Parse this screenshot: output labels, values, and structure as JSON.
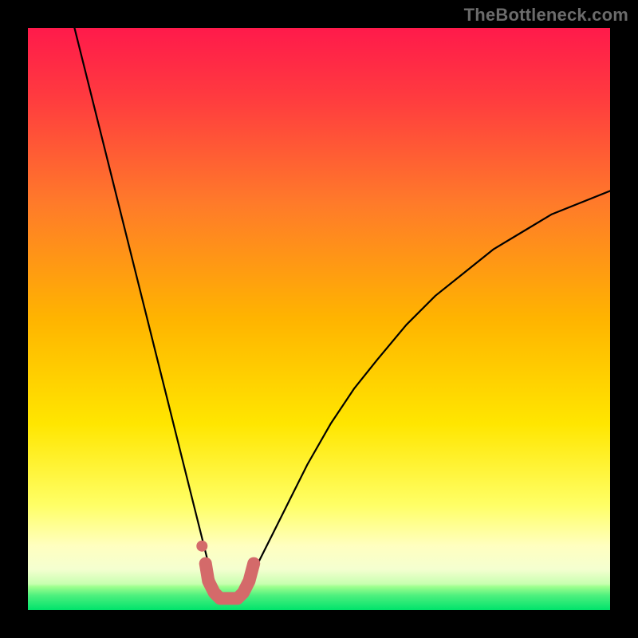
{
  "watermark": {
    "text": "TheBottleneck.com"
  },
  "chart_data": {
    "type": "line",
    "title": "",
    "xlabel": "",
    "ylabel": "",
    "xlim": [
      0,
      100
    ],
    "ylim": [
      0,
      100
    ],
    "grid": false,
    "legend": false,
    "background_gradient": {
      "top_color": "#ff1a4b",
      "mid_color": "#ffd400",
      "bottom_band_color": "#00e36b",
      "bottom_band_start_pct": 96
    },
    "series": [
      {
        "name": "bottleneck-curve",
        "color": "#000000",
        "x": [
          8,
          10,
          12,
          14,
          16,
          18,
          20,
          22,
          24,
          26,
          28,
          30,
          31,
          32,
          33,
          34,
          35,
          36,
          37,
          38,
          40,
          42,
          45,
          48,
          52,
          56,
          60,
          65,
          70,
          75,
          80,
          85,
          90,
          95,
          100
        ],
        "y": [
          100,
          92,
          84,
          76,
          68,
          60,
          52,
          44,
          36,
          28,
          20,
          12,
          8,
          5,
          3,
          2,
          2,
          2,
          3,
          5,
          9,
          13,
          19,
          25,
          32,
          38,
          43,
          49,
          54,
          58,
          62,
          65,
          68,
          70,
          72
        ]
      },
      {
        "name": "optimal-range-marker",
        "color": "#d46a6a",
        "style": "thick-dots",
        "x": [
          30.5,
          31,
          32,
          33,
          34,
          35,
          36,
          37,
          38,
          38.8
        ],
        "y": [
          8,
          5,
          3,
          2,
          2,
          2,
          2,
          3,
          5,
          8
        ]
      }
    ],
    "annotations": []
  }
}
